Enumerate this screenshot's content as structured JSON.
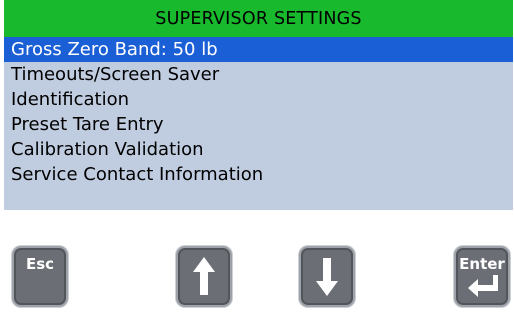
{
  "header": {
    "title": "SUPERVISOR SETTINGS"
  },
  "menu": {
    "items": [
      {
        "label": "Gross Zero Band: 50 lb",
        "selected": true
      },
      {
        "label": "Timeouts/Screen Saver",
        "selected": false
      },
      {
        "label": "Identification",
        "selected": false
      },
      {
        "label": "Preset Tare Entry",
        "selected": false
      },
      {
        "label": "Calibration Validation",
        "selected": false
      },
      {
        "label": "Service Contact Information",
        "selected": false
      }
    ]
  },
  "keys": {
    "esc_label": "Esc",
    "up_icon": "arrow-up-icon",
    "down_icon": "arrow-down-icon",
    "enter_label": "Enter",
    "enter_icon": "enter-return-icon"
  },
  "colors": {
    "header_bg": "#19b92d",
    "screen_bg": "#c0cce0",
    "selection_bg": "#1b5fd6",
    "key_bg": "#6b6f75"
  }
}
